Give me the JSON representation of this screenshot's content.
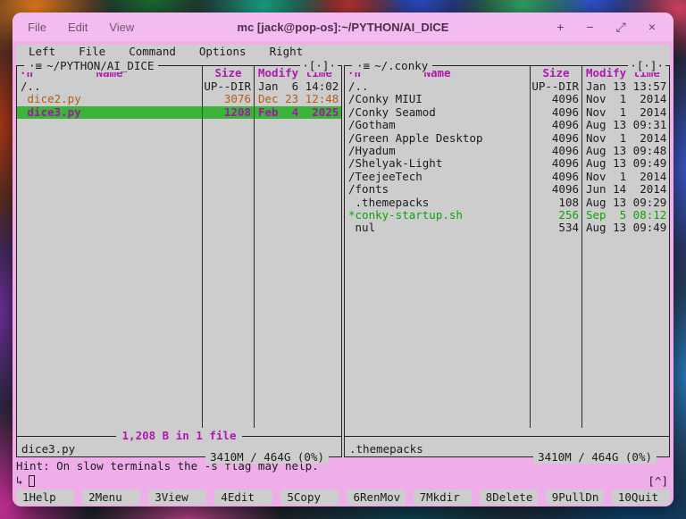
{
  "titlebar": {
    "menus": [
      "File",
      "Edit",
      "View"
    ],
    "title": "mc [jack@pop-os]:~/PYTHON/AI_DICE",
    "controls": [
      {
        "name": "new-tab-icon",
        "glyph": "+"
      },
      {
        "name": "minimize-icon",
        "glyph": "−"
      },
      {
        "name": "maximize-icon",
        "glyph": "⤢"
      },
      {
        "name": "close-icon",
        "glyph": "×"
      }
    ]
  },
  "menubar": {
    "items": [
      "Left",
      "File",
      "Command",
      "Options",
      "Right"
    ]
  },
  "panels": {
    "left": {
      "path": "~/PYTHON/AI_DICE",
      "marker": "·≡",
      "corner": "·[·]·",
      "sort_indicator": "·n",
      "columns": {
        "name": "Name",
        "size": "Size",
        "mtime": "Modify time"
      },
      "rows": [
        {
          "name": "/..",
          "size": "UP--DIR",
          "mtime": "Jan  6 14:02",
          "type": "dir"
        },
        {
          "name": " dice2.py",
          "size": "3076",
          "mtime": "Dec 23 12:48",
          "type": "source"
        },
        {
          "name": " dice3.py",
          "size": "1208",
          "mtime": "Feb  4  2025",
          "type": "selected"
        }
      ],
      "summary": "1,208 B in 1 file",
      "status": "dice3.py",
      "disk": "3410M / 464G (0%)"
    },
    "right": {
      "path": "~/.conky",
      "marker": "·≡",
      "corner": "·[·]·",
      "sort_indicator": "·n",
      "columns": {
        "name": "Name",
        "size": "Size",
        "mtime": "Modify time"
      },
      "rows": [
        {
          "name": "/..",
          "size": "UP--DIR",
          "mtime": "Jan 13 13:57",
          "type": "dir"
        },
        {
          "name": "/Conky MIUI",
          "size": "4096",
          "mtime": "Nov  1  2014",
          "type": "dir"
        },
        {
          "name": "/Conky Seamod",
          "size": "4096",
          "mtime": "Nov  1  2014",
          "type": "dir"
        },
        {
          "name": "/Gotham",
          "size": "4096",
          "mtime": "Aug 13 09:31",
          "type": "dir"
        },
        {
          "name": "/Green Apple Desktop",
          "size": "4096",
          "mtime": "Nov  1  2014",
          "type": "dir"
        },
        {
          "name": "/Hyadum",
          "size": "4096",
          "mtime": "Aug 13 09:48",
          "type": "dir"
        },
        {
          "name": "/Shelyak-Light",
          "size": "4096",
          "mtime": "Aug 13 09:49",
          "type": "dir"
        },
        {
          "name": "/TeejeeTech",
          "size": "4096",
          "mtime": "Nov  1  2014",
          "type": "dir"
        },
        {
          "name": "/fonts",
          "size": "4096",
          "mtime": "Jun 14  2014",
          "type": "dir"
        },
        {
          "name": " .themepacks",
          "size": "108",
          "mtime": "Aug 13 09:29",
          "type": "plain"
        },
        {
          "name": "*conky-startup.sh",
          "size": "256",
          "mtime": "Sep  5 08:12",
          "type": "exec"
        },
        {
          "name": " nul",
          "size": "534",
          "mtime": "Aug 13 09:49",
          "type": "plain"
        }
      ],
      "summary": "",
      "status": ".themepacks",
      "disk": "3410M / 464G (0%)"
    }
  },
  "hint": "Hint: On slow terminals the -s flag may help.",
  "prompt": {
    "symbol": "↳",
    "updir": "[^]"
  },
  "fnkeys": [
    {
      "num": "1",
      "label": "Help"
    },
    {
      "num": "2",
      "label": "Menu"
    },
    {
      "num": "3",
      "label": "View"
    },
    {
      "num": "4",
      "label": "Edit"
    },
    {
      "num": "5",
      "label": "Copy"
    },
    {
      "num": "6",
      "label": "RenMov"
    },
    {
      "num": "7",
      "label": "Mkdir"
    },
    {
      "num": "8",
      "label": "Delete"
    },
    {
      "num": "9",
      "label": "PullDn"
    },
    {
      "num": "10",
      "label": "Quit"
    }
  ]
}
